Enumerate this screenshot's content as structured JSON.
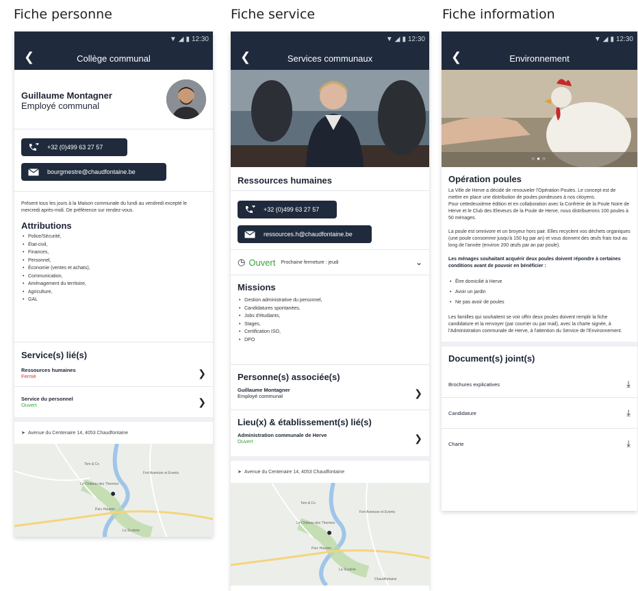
{
  "columns": {
    "person": "Fiche personne",
    "service": "Fiche service",
    "info": "Fiche information"
  },
  "status": {
    "time": "12:30"
  },
  "person": {
    "header_title": "Collège communal",
    "name": "Guillaume Montagner",
    "role": "Employé communal",
    "phone": "+32 (0)499 63 27 57",
    "email": "bourgmestre@chaudfontaine.be",
    "presence": "Présent tous les jours à la Maison communale du lundi au vendredi excepté le mercredi après-midi. De préférence sur rendez-vous.",
    "attributions_title": "Attributions",
    "attributions": [
      "Police/Sécurité,",
      "État-civil,",
      "Finances,",
      "Personnel,",
      "Économie (ventes et achats),",
      "Communication,",
      "Aménagement du territoire,",
      "Agriculture,",
      "GAL"
    ],
    "linked_title": "Service(s) lié(s)",
    "linked": [
      {
        "name": "Ressources humaines",
        "status": "Fermé"
      },
      {
        "name": "Service du personnel",
        "status": "Ouvert"
      }
    ],
    "address": "Avenue du Centenaire 14, 4053 Chaudfontaine"
  },
  "service": {
    "header_title": "Services communaux",
    "name": "Ressources humaines",
    "phone": "+32 (0)499 63 27 57",
    "email": "ressources.h@chaudfontaine.be",
    "open_status": "Ouvert",
    "next_close": "Prochaine fermeture : jeudi",
    "missions_title": "Missions",
    "missions": [
      "Gestion administrative du personnel,",
      "Candidatures spontanées,",
      "Jobs d'étudiants,",
      "Stages,",
      "Certification ISO,",
      "DPO"
    ],
    "persons_title": "Personne(s) associée(s)",
    "person_name": "Guillaume Montagner",
    "person_role": "Employé communal",
    "places_title": "Lieu(x) & établissement(s) lié(s)",
    "place_name": "Administration communale de Herve",
    "place_status": "Ouvert",
    "address": "Avenue du Centenaire 14, 4053 Chaudfontaine"
  },
  "info": {
    "header_title": "Environnement",
    "title": "Opération poules",
    "p1": "La Ville de Herve a décidé de renouveler l'Opération Poules. Le concept est de mettre en place une distribution de poules pondeuses à nos citoyens.",
    "p2": "Pour cettedeuxième édition et en collaboration avec la Confrérie de la Poule Noire de Herve et le Club des Eleveurs de la Poule de Herve, nous distribuerons 100 poules à 50 ménages.",
    "p3": "La poule est omnivore et un broyeur hors pair. Elles recyclent vos déchets organiques (une poule consomme jusqu'à 150 kg par an) et vous donnent des œufs frais tout au long de l'année (environ 200 œufs par an par poule).",
    "p4": "Les ménages souhaitant acquérir deux poules doivent répondre à certaines conditions avant de pouvoir en bénéficier :",
    "conditions": [
      "Être domicilié à Herve",
      "Avoir un jardin",
      "Ne pas avoir de poules"
    ],
    "p5": "Les familles qui souhaitent se voir offrir deux poules doivent remplir la fiche candidature et la renvoyer (par courrier ou par mail), avec la charte signée, à l'Administration communale de Herve, à l'attention du Service de l'Environnement.",
    "docs_title": "Document(s) joint(s)",
    "docs": [
      "Brochures explicatives",
      "Candidature",
      "Charte"
    ]
  },
  "map": {
    "labels": [
      "Tom & Co",
      "Fort Aventure et Events",
      "Le Château des Thermes",
      "Parc Hauster",
      "La Sculerie",
      "Chaudfontaine"
    ]
  }
}
